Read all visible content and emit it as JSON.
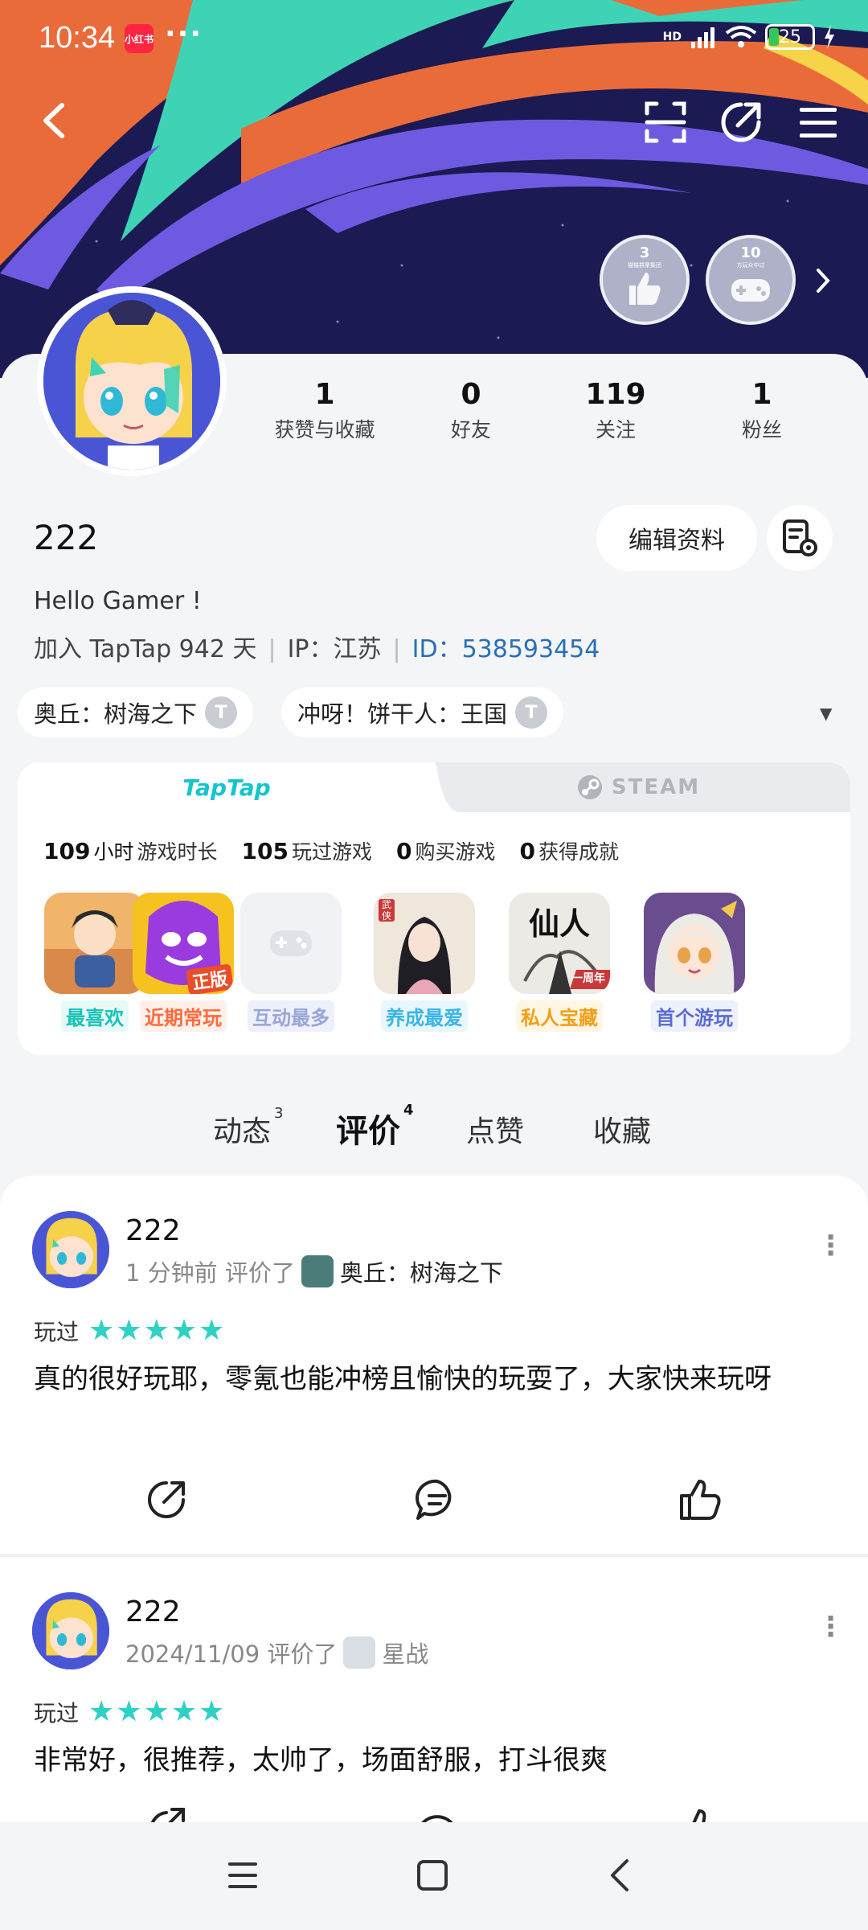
{
  "status_bar": {
    "time": "10:34",
    "app_badge": "小红书",
    "dots": "···",
    "network": "HD",
    "battery": "25"
  },
  "achievements": [
    {
      "num": "3",
      "sub": "猫猫群聚集团"
    },
    {
      "num": "10",
      "sub": "方玩众中过"
    }
  ],
  "stats": [
    {
      "value": "1",
      "label": "获赞与收藏"
    },
    {
      "value": "0",
      "label": "好友"
    },
    {
      "value": "119",
      "label": "关注"
    },
    {
      "value": "1",
      "label": "粉丝"
    }
  ],
  "profile": {
    "username": "222",
    "edit_label": "编辑资料",
    "bio": "Hello Gamer !",
    "joined": "加入 TapTap 942 天",
    "ip": "IP：江苏",
    "id": "ID：538593454"
  },
  "tags": [
    {
      "label": "奥丘：树海之下",
      "badge": "T"
    },
    {
      "label": "冲呀！饼干人：王国",
      "badge": "T"
    }
  ],
  "game_panel": {
    "tab_taptap": "TapTap",
    "tab_steam": "STEAM",
    "stats": [
      {
        "value": "109",
        "unit": "小时",
        "label": "游戏时长"
      },
      {
        "value": "105",
        "unit": "",
        "label": "玩过游戏"
      },
      {
        "value": "0",
        "unit": "",
        "label": "购买游戏"
      },
      {
        "value": "0",
        "unit": "",
        "label": "获得成就"
      }
    ],
    "games": [
      {
        "label": "最喜欢",
        "color": "#19c2b8",
        "bg": "#e6faf7"
      },
      {
        "label": "近期常玩",
        "color": "#ff6a3d",
        "bg": "#fff0ea",
        "badge": "正版"
      },
      {
        "label": "互动最多",
        "color": "#9aa6d8",
        "bg": "#eef0fb"
      },
      {
        "label": "养成最爱",
        "color": "#3ab5e6",
        "bg": "#e8f6fd",
        "seal": "武侠"
      },
      {
        "label": "私人宝藏",
        "color": "#f0a01a",
        "bg": "#fff6e3",
        "title": "仙人",
        "ribbon": "一周年"
      },
      {
        "label": "首个游玩",
        "color": "#5a6bd6",
        "bg": "#eef0fb"
      }
    ]
  },
  "feed_tabs": [
    {
      "label": "动态",
      "count": "3"
    },
    {
      "label": "评价",
      "count": "4"
    },
    {
      "label": "点赞",
      "count": ""
    },
    {
      "label": "收藏",
      "count": ""
    }
  ],
  "reviews": [
    {
      "name": "222",
      "time": "1 分钟前 评价了",
      "game": "奥丘：树海之下",
      "rating_label": "玩过",
      "stars": "★★★★★",
      "text": "真的很好玩耶，零氪也能冲榜且愉快的玩耍了，大家快来玩呀"
    },
    {
      "name": "222",
      "time": "2024/11/09 评价了",
      "game": "星战",
      "rating_label": "玩过",
      "stars": "★★★★★",
      "text": "非常好，很推荐，太帅了，场面舒服，打斗很爽"
    }
  ]
}
